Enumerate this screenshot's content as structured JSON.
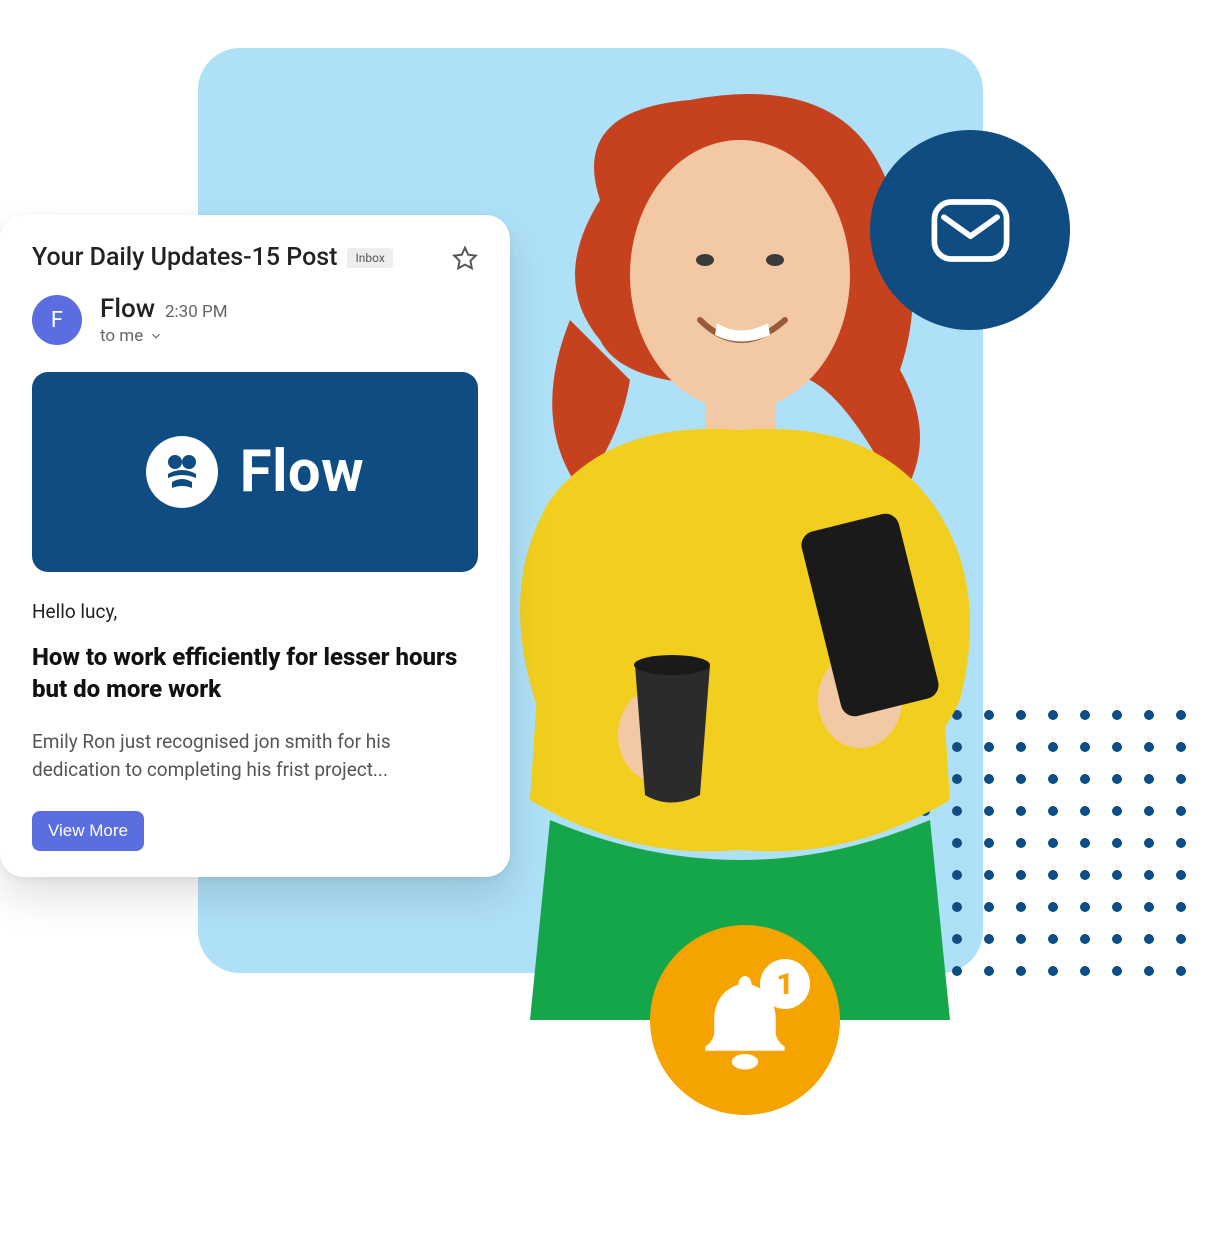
{
  "email": {
    "subject": "Your Daily Updates-15 Post",
    "tag": "Inbox",
    "sender": {
      "initial": "F",
      "name": "Flow",
      "time": "2:30 PM",
      "recipient_line": "to me"
    },
    "brand": {
      "name": "Flow"
    },
    "greeting": "Hello lucy,",
    "headline": "How to work efficiently for lesser hours but do more work",
    "preview": "Emily Ron just recognised jon smith for his dedication to completing his frist project...",
    "cta_label": "View More"
  },
  "notification": {
    "count": "1"
  }
}
